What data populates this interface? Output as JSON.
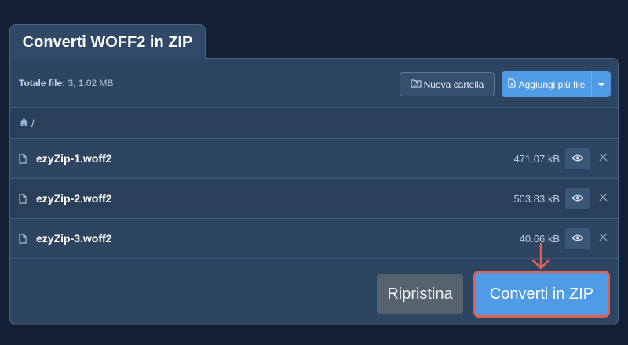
{
  "tab": {
    "title": "Converti WOFF2 in ZIP"
  },
  "summary": {
    "label": "Totale file:",
    "value": "3, 1.02 MB"
  },
  "toolbar": {
    "new_folder_label": "Nuova cartella",
    "add_files_label": "Aggiungi più file"
  },
  "breadcrumb": {
    "path": "/"
  },
  "files": [
    {
      "name": "ezyZip-1.woff2",
      "size": "471.07 kB"
    },
    {
      "name": "ezyZip-2.woff2",
      "size": "503.83 kB"
    },
    {
      "name": "ezyZip-3.woff2",
      "size": "40.66 kB"
    }
  ],
  "actions": {
    "reset_label": "Ripristina",
    "convert_label": "Converti in ZIP"
  },
  "colors": {
    "background": "#132033",
    "panel": "#2d4560",
    "primary": "#4f9be6",
    "secondary": "#56636f",
    "highlight": "#e35f52"
  },
  "icons": [
    "folder-refresh-icon",
    "file-plus-icon",
    "chevron-down-icon",
    "home-icon",
    "file-icon",
    "eye-icon",
    "close-icon",
    "arrow-down-icon"
  ]
}
